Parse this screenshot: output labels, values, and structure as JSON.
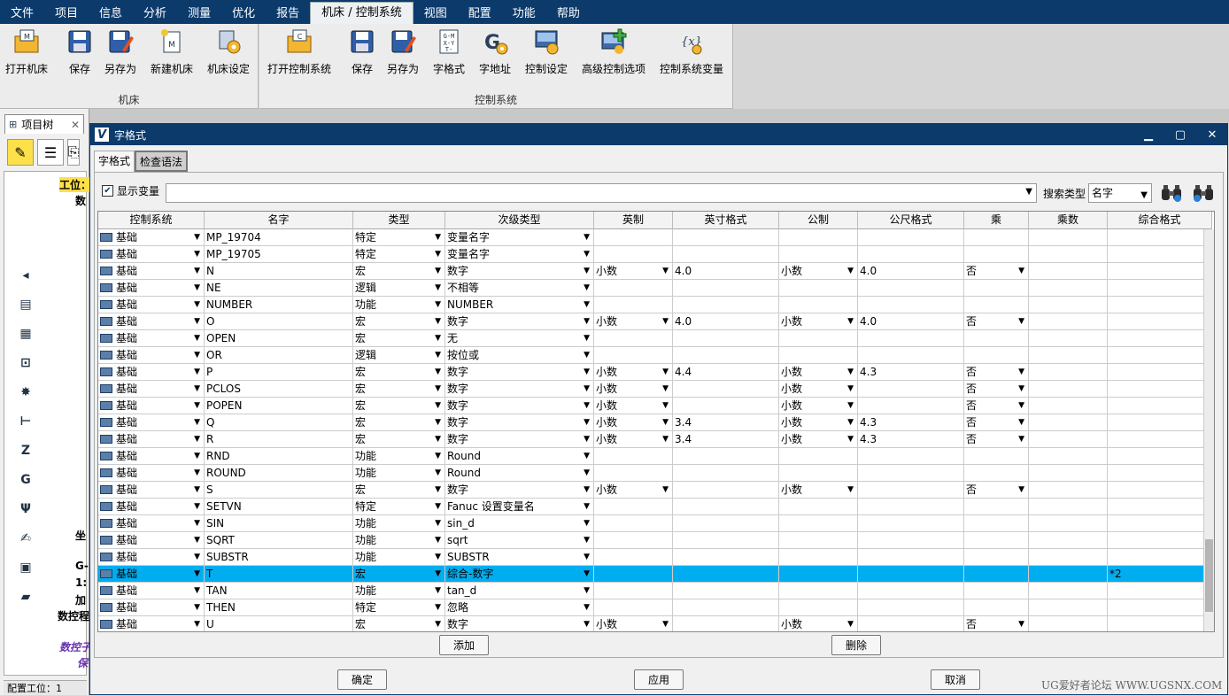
{
  "menu": [
    "文件",
    "项目",
    "信息",
    "分析",
    "测量",
    "优化",
    "报告",
    "机床 / 控制系统",
    "视图",
    "配置",
    "功能",
    "帮助"
  ],
  "ribbon": {
    "machine_group": {
      "label": "机床",
      "buttons": [
        {
          "label": "打开机床",
          "icon": "open-machine-icon"
        },
        {
          "label": "保存",
          "icon": "save-icon"
        },
        {
          "label": "另存为",
          "icon": "save-as-icon"
        },
        {
          "label": "新建机床",
          "icon": "new-machine-icon"
        },
        {
          "label": "机床设定",
          "icon": "machine-settings-icon"
        }
      ]
    },
    "control_group": {
      "label": "控制系统",
      "buttons": [
        {
          "label": "打开控制系统",
          "icon": "open-control-icon"
        },
        {
          "label": "保存",
          "icon": "save-icon"
        },
        {
          "label": "另存为",
          "icon": "save-as-icon"
        },
        {
          "label": "字格式",
          "icon": "word-format-icon"
        },
        {
          "label": "字地址",
          "icon": "word-address-icon"
        },
        {
          "label": "控制设定",
          "icon": "control-settings-icon"
        },
        {
          "label": "高级控制选项",
          "icon": "advanced-control-icon"
        },
        {
          "label": "控制系统变量",
          "icon": "control-variables-icon"
        }
      ]
    }
  },
  "left_panel": {
    "tab_label": "项目树",
    "tree": [
      "工位：",
      "数",
      "坐",
      "G-",
      "1:",
      "加",
      "数控程",
      "数控子",
      "保"
    ],
    "status": "配置工位：1"
  },
  "dialog": {
    "title": "字格式",
    "tabs": [
      "字格式",
      "检查语法"
    ],
    "show_variables_label": "显示变量",
    "show_variables_checked": true,
    "search_type_label": "搜索类型",
    "search_type_value": "名字",
    "columns": [
      "控制系统",
      "名字",
      "类型",
      "次级类型",
      "英制",
      "英寸格式",
      "公制",
      "公尺格式",
      "乘",
      "乘数",
      "综合格式"
    ],
    "rows": [
      [
        "基础",
        "MP_19704",
        "特定",
        "变量名字",
        "",
        "",
        "",
        "",
        "",
        "",
        ""
      ],
      [
        "基础",
        "MP_19705",
        "特定",
        "变量名字",
        "",
        "",
        "",
        "",
        "",
        "",
        ""
      ],
      [
        "基础",
        "N",
        "宏",
        "数字",
        "小数",
        "4.0",
        "小数",
        "4.0",
        "否",
        "",
        ""
      ],
      [
        "基础",
        "NE",
        "逻辑",
        "不相等",
        "",
        "",
        "",
        "",
        "",
        "",
        ""
      ],
      [
        "基础",
        "NUMBER",
        "功能",
        "NUMBER",
        "",
        "",
        "",
        "",
        "",
        "",
        ""
      ],
      [
        "基础",
        "O",
        "宏",
        "数字",
        "小数",
        "4.0",
        "小数",
        "4.0",
        "否",
        "",
        ""
      ],
      [
        "基础",
        "OPEN",
        "宏",
        "无",
        "",
        "",
        "",
        "",
        "",
        "",
        ""
      ],
      [
        "基础",
        "OR",
        "逻辑",
        "按位或",
        "",
        "",
        "",
        "",
        "",
        "",
        ""
      ],
      [
        "基础",
        "P",
        "宏",
        "数字",
        "小数",
        "4.4",
        "小数",
        "4.3",
        "否",
        "",
        ""
      ],
      [
        "基础",
        "PCLOS",
        "宏",
        "数字",
        "小数",
        "",
        "小数",
        "",
        "否",
        "",
        ""
      ],
      [
        "基础",
        "POPEN",
        "宏",
        "数字",
        "小数",
        "",
        "小数",
        "",
        "否",
        "",
        ""
      ],
      [
        "基础",
        "Q",
        "宏",
        "数字",
        "小数",
        "3.4",
        "小数",
        "4.3",
        "否",
        "",
        ""
      ],
      [
        "基础",
        "R",
        "宏",
        "数字",
        "小数",
        "3.4",
        "小数",
        "4.3",
        "否",
        "",
        ""
      ],
      [
        "基础",
        "RND",
        "功能",
        "Round",
        "",
        "",
        "",
        "",
        "",
        "",
        ""
      ],
      [
        "基础",
        "ROUND",
        "功能",
        "Round",
        "",
        "",
        "",
        "",
        "",
        "",
        ""
      ],
      [
        "基础",
        "S",
        "宏",
        "数字",
        "小数",
        "",
        "小数",
        "",
        "否",
        "",
        ""
      ],
      [
        "基础",
        "SETVN",
        "特定",
        "Fanuc 设置变量名",
        "",
        "",
        "",
        "",
        "",
        "",
        ""
      ],
      [
        "基础",
        "SIN",
        "功能",
        "sin_d",
        "",
        "",
        "",
        "",
        "",
        "",
        ""
      ],
      [
        "基础",
        "SQRT",
        "功能",
        "sqrt",
        "",
        "",
        "",
        "",
        "",
        "",
        ""
      ],
      [
        "基础",
        "SUBSTR",
        "功能",
        "SUBSTR",
        "",
        "",
        "",
        "",
        "",
        "",
        ""
      ],
      [
        "基础",
        "T",
        "宏",
        "综合-数字",
        "",
        "",
        "",
        "",
        "",
        "",
        "*2"
      ],
      [
        "基础",
        "TAN",
        "功能",
        "tan_d",
        "",
        "",
        "",
        "",
        "",
        "",
        ""
      ],
      [
        "基础",
        "THEN",
        "特定",
        "忽略",
        "",
        "",
        "",
        "",
        "",
        "",
        ""
      ],
      [
        "基础",
        "U",
        "宏",
        "数字",
        "小数",
        "",
        "小数",
        "",
        "否",
        "",
        ""
      ]
    ],
    "selected_row": 20,
    "add_label": "添加",
    "delete_label": "删除",
    "ok_label": "确定",
    "apply_label": "应用",
    "cancel_label": "取消"
  },
  "watermark": "UG爱好者论坛 WWW.UGSNX.COM",
  "colors": {
    "titlebar": "#0b3a6b",
    "selection": "#00aef0"
  }
}
